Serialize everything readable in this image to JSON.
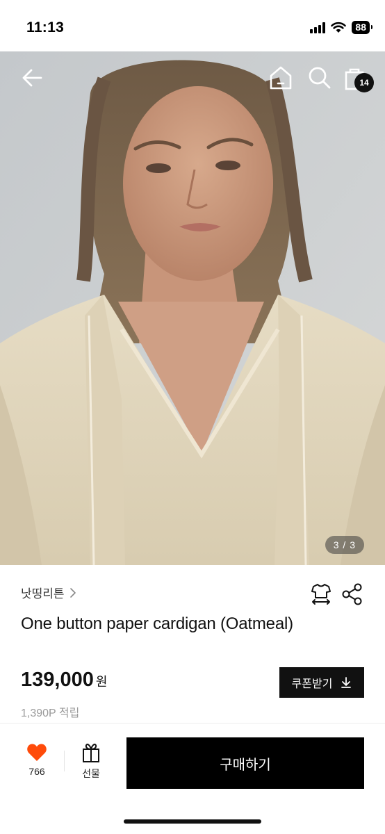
{
  "status_bar": {
    "time": "11:13",
    "battery": "88"
  },
  "nav": {
    "cart_count": "14"
  },
  "gallery": {
    "page_indicator": "3 / 3"
  },
  "product": {
    "brand": "낫띵리튼",
    "title": "One button paper cardigan (Oatmeal)",
    "price": "139,000",
    "currency": "원",
    "points": "1,390P 적립",
    "coupon_label": "쿠폰받기"
  },
  "bottom_bar": {
    "like_count": "766",
    "gift_label": "선물",
    "buy_label": "구매하기"
  },
  "icons": [
    "back-arrow-icon",
    "home-icon",
    "search-icon",
    "shopping-bag-icon",
    "chevron-right-icon",
    "size-guide-shirt-icon",
    "share-icon",
    "download-icon",
    "heart-icon",
    "gift-icon"
  ],
  "colors": {
    "heart": "#ff4b0a",
    "buy_button": "#000000",
    "coupon_button": "#111111"
  }
}
